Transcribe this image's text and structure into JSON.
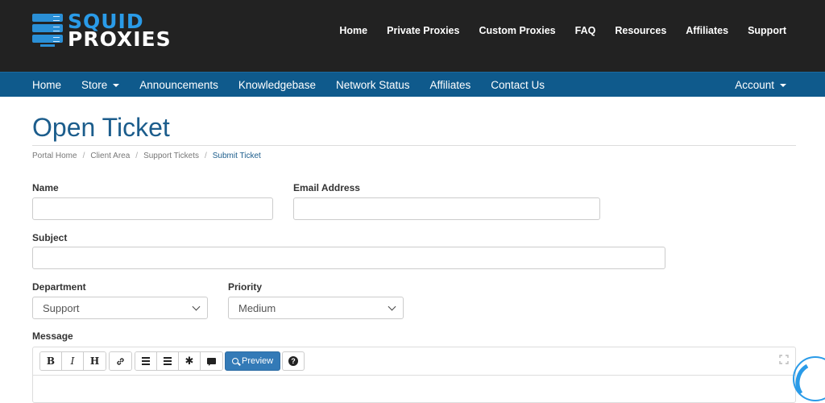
{
  "brand": {
    "line1": "SQUID",
    "line2": "PROXIES"
  },
  "topnav": [
    "Home",
    "Private Proxies",
    "Custom Proxies",
    "FAQ",
    "Resources",
    "Affiliates",
    "Support"
  ],
  "navbar": {
    "items": [
      "Home",
      "Store",
      "Announcements",
      "Knowledgebase",
      "Network Status",
      "Affiliates",
      "Contact Us"
    ],
    "account": "Account"
  },
  "page": {
    "title": "Open Ticket",
    "breadcrumb": [
      "Portal Home",
      "Client Area",
      "Support Tickets",
      "Submit Ticket"
    ]
  },
  "form": {
    "name_label": "Name",
    "name_value": "",
    "email_label": "Email Address",
    "email_value": "",
    "subject_label": "Subject",
    "subject_value": "",
    "department_label": "Department",
    "department_value": "Support",
    "priority_label": "Priority",
    "priority_value": "Medium",
    "message_label": "Message"
  },
  "editor": {
    "bold": "B",
    "italic": "I",
    "heading": "H",
    "preview_label": "Preview",
    "help": "?"
  },
  "colors": {
    "header_bg": "#222222",
    "navbar_bg": "#0f5a8c",
    "accent": "#1c5d8c",
    "button": "#337ab7"
  }
}
